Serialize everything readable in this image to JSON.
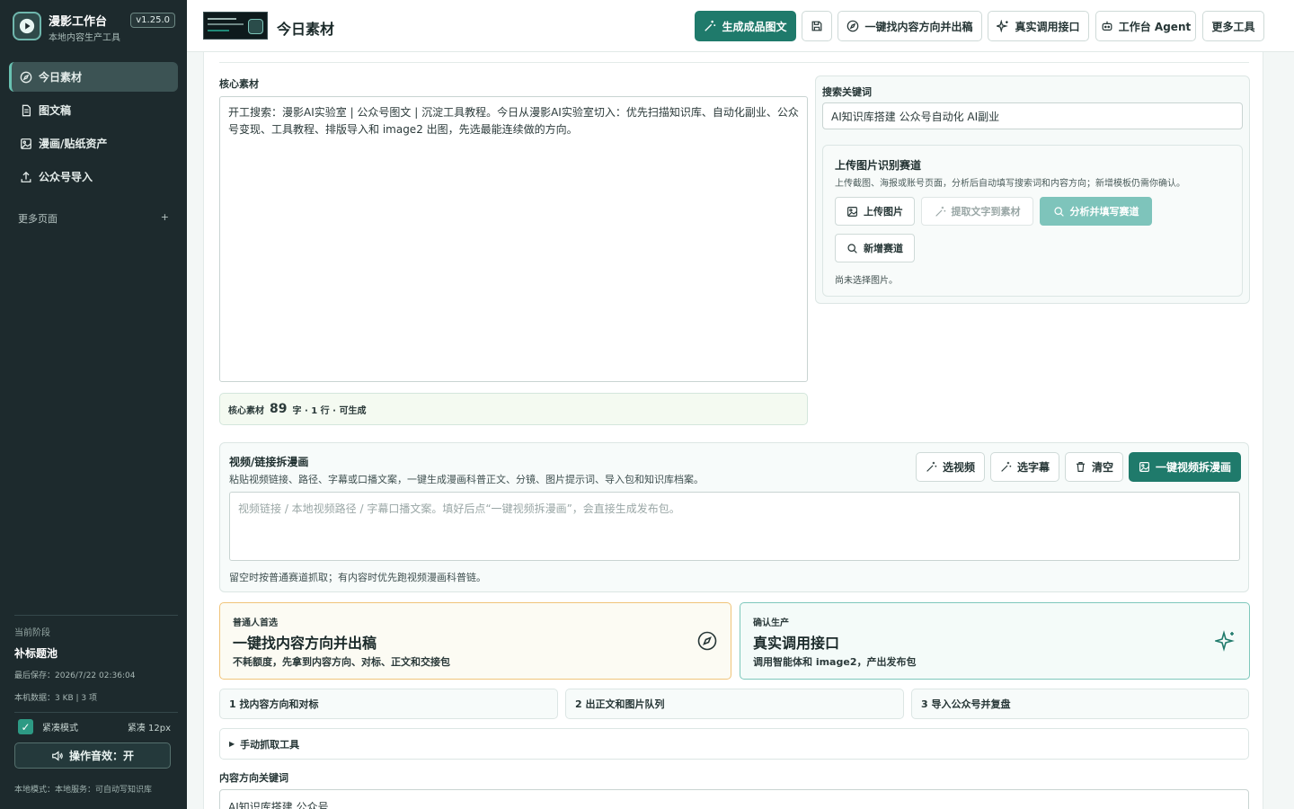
{
  "sidebar": {
    "brand_title": "漫影工作台",
    "brand_sub": "本地内容生产工具",
    "version": "v1.25.0",
    "items": [
      {
        "label": "今日素材",
        "icon": "compass-icon"
      },
      {
        "label": "图文稿",
        "icon": "document-icon"
      },
      {
        "label": "漫画/贴纸资产",
        "icon": "image-icon"
      },
      {
        "label": "公众号导入",
        "icon": "upload-icon"
      }
    ],
    "more_pages": "更多页面",
    "more_pages_toggle": "+",
    "stage_label": "当前阶段",
    "stage_value": "补标题池",
    "last_saved": "最后保存：2026/7/22 02:36:04",
    "local_data": "本机数据：3 KB | 3 项",
    "compact_label": "紧凑模式",
    "compact_value": "紧凑 12px",
    "compact_checked": "✓",
    "sound_label": "操作音效：开",
    "local_mode": "本地模式：本地服务：可自动写知识库"
  },
  "topbar": {
    "page_title": "今日素材",
    "generate_label": "生成成品图文",
    "find_direction_label": "一键找内容方向并出稿",
    "real_api_label": "真实调用接口",
    "agent_label": "工作台 Agent",
    "more_tools_label": "更多工具"
  },
  "core": {
    "label": "核心素材",
    "text": "开工搜索：漫影AI实验室 | 公众号图文 | 沉淀工具教程。今日从漫影AI实验室切入：优先扫描知识库、自动化副业、公众号变现、工具教程、排版导入和 image2 出图，先选最能连续做的方向。",
    "count_prefix": "核心素材",
    "count_num": "89",
    "count_suffix": "字 · 1 行 · 可生成"
  },
  "search": {
    "label": "搜索关键词",
    "value": "AI知识库搭建 公众号自动化 AI副业"
  },
  "upload": {
    "title": "上传图片识别赛道",
    "desc": "上传截图、海报或账号页面，分析后自动填写搜索词和内容方向；新增模板仍需你确认。",
    "upload_btn": "上传图片",
    "extract_btn": "提取文字到素材",
    "analyze_btn": "分析并填写赛道",
    "new_track_btn": "新增赛道",
    "empty": "尚未选择图片。"
  },
  "video": {
    "title": "视频/链接拆漫画",
    "desc": "粘贴视频链接、路径、字幕或口播文案，一键生成漫画科普正文、分镜、图片提示词、导入包和知识库档案。",
    "select_video": "选视频",
    "select_subtitle": "选字幕",
    "clear": "清空",
    "one_click": "一键视频拆漫画",
    "placeholder": "视频链接 / 本地视频路径 / 字幕口播文案。填好后点“一键视频拆漫画”，会直接生成发布包。",
    "hint": "留空时按普通赛道抓取；有内容时优先跑视频漫画科普链。"
  },
  "actions": [
    {
      "kicker": "普通人首选",
      "title": "一键找内容方向并出稿",
      "desc": "不耗额度，先拿到内容方向、对标、正文和交接包",
      "icon": "compass-icon"
    },
    {
      "kicker": "确认生产",
      "title": "真实调用接口",
      "desc": "调用智能体和 image2，产出发布包",
      "icon": "sparkles-icon"
    }
  ],
  "steps": [
    "1 找内容方向和对标",
    "2 出正文和图片队列",
    "3 导入公众号并复盘"
  ],
  "manual": {
    "toggle": "▶",
    "label": "手动抓取工具"
  },
  "keywords": {
    "label": "内容方向关键词",
    "value": "AI知识库搭建 公众号"
  },
  "colors": {
    "accent": "#1f7a6b",
    "sidebar_bg": "#1d2a2d",
    "warm_border": "#f0c47a"
  }
}
